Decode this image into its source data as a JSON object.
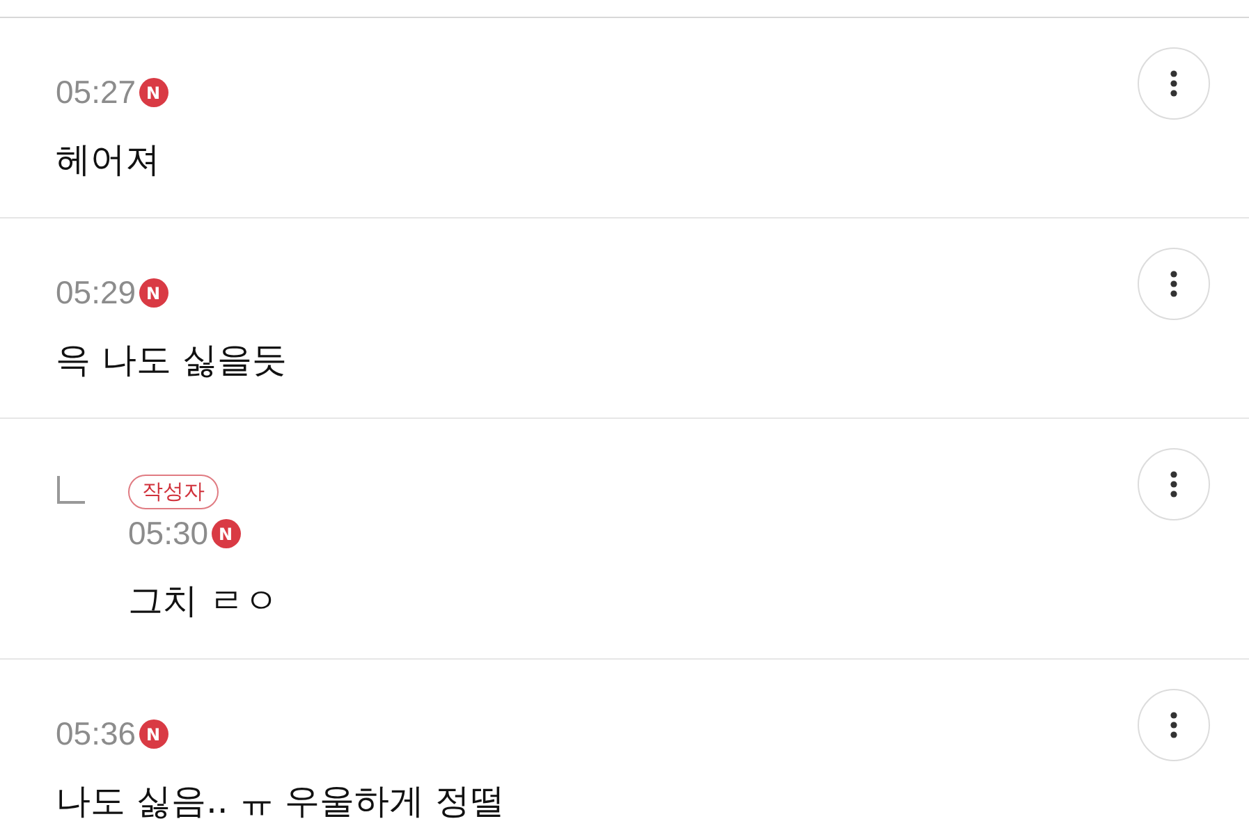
{
  "comments": [
    {
      "time": "05:27",
      "badge": "N",
      "text": "헤어져"
    },
    {
      "time": "05:29",
      "badge": "N",
      "text": "윽 나도 싫을듯",
      "children": [
        {
          "author_tag": "작성자",
          "time": "05:30",
          "badge": "N",
          "text": "그치 ㄹㅇ"
        }
      ]
    },
    {
      "time": "05:36",
      "badge": "N",
      "text": "나도 싫음.. ㅠ 우울하게 정떨"
    }
  ]
}
